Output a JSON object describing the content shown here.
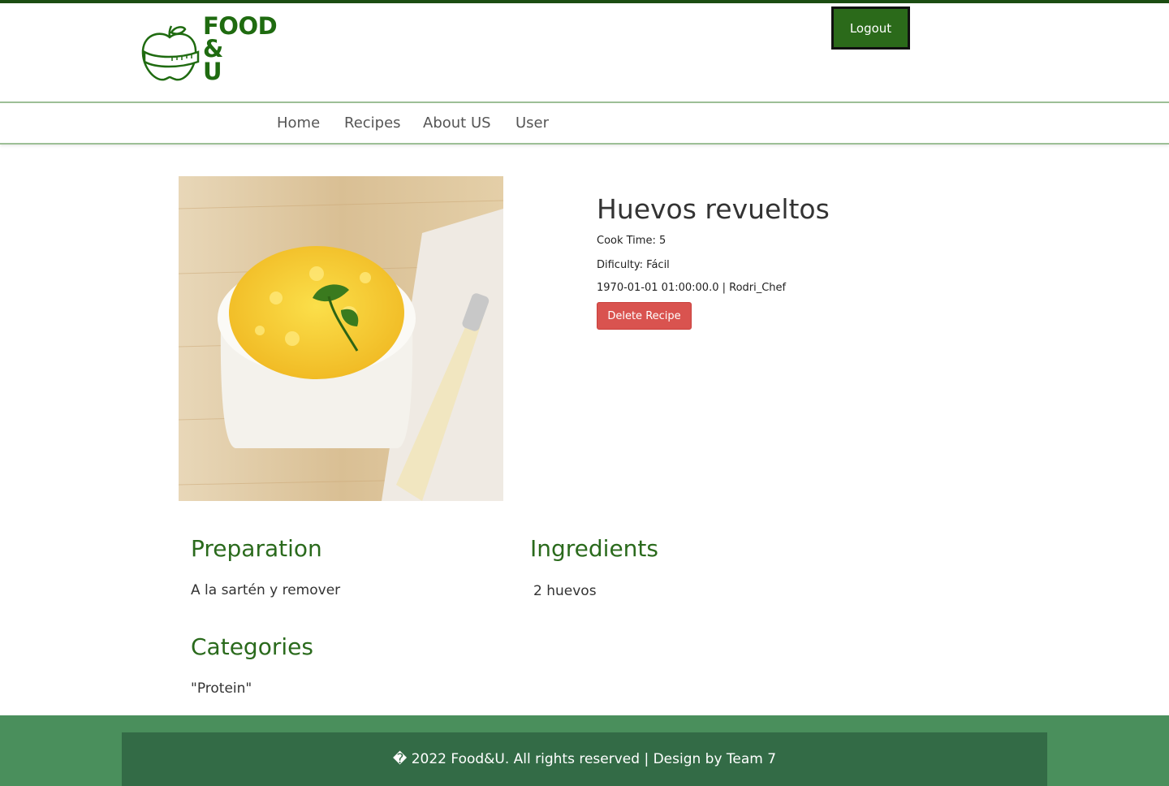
{
  "header": {
    "logo": {
      "line1": "FOOD",
      "line2": "&",
      "line3": "U"
    },
    "logout_label": "Logout"
  },
  "nav": {
    "items": [
      {
        "label": "Home"
      },
      {
        "label": "Recipes"
      },
      {
        "label": "About US"
      },
      {
        "label": "User"
      }
    ]
  },
  "recipe": {
    "title": "Huevos revueltos",
    "cook_time": "Cook Time: 5",
    "difficulty": "Dificulty: Fácil",
    "date_author": "1970-01-01 01:00:00.0 | Rodri_Chef",
    "delete_label": "Delete Recipe",
    "preparation_title": "Preparation",
    "preparation_text": "A la sartén y remover",
    "ingredients_title": "Ingredients",
    "ingredients_text": "2 huevos",
    "categories_title": "Categories",
    "categories_text": "\"Protein\""
  },
  "footer": {
    "text": "� 2022 Food&U. All rights reserved | Design by Team 7"
  },
  "colors": {
    "brand_green": "#1f6b10",
    "logout_bg": "#2b6a1a",
    "delete_bg": "#d9534f",
    "footer_outer": "#4a8f5c",
    "footer_inner": "#336b46"
  }
}
